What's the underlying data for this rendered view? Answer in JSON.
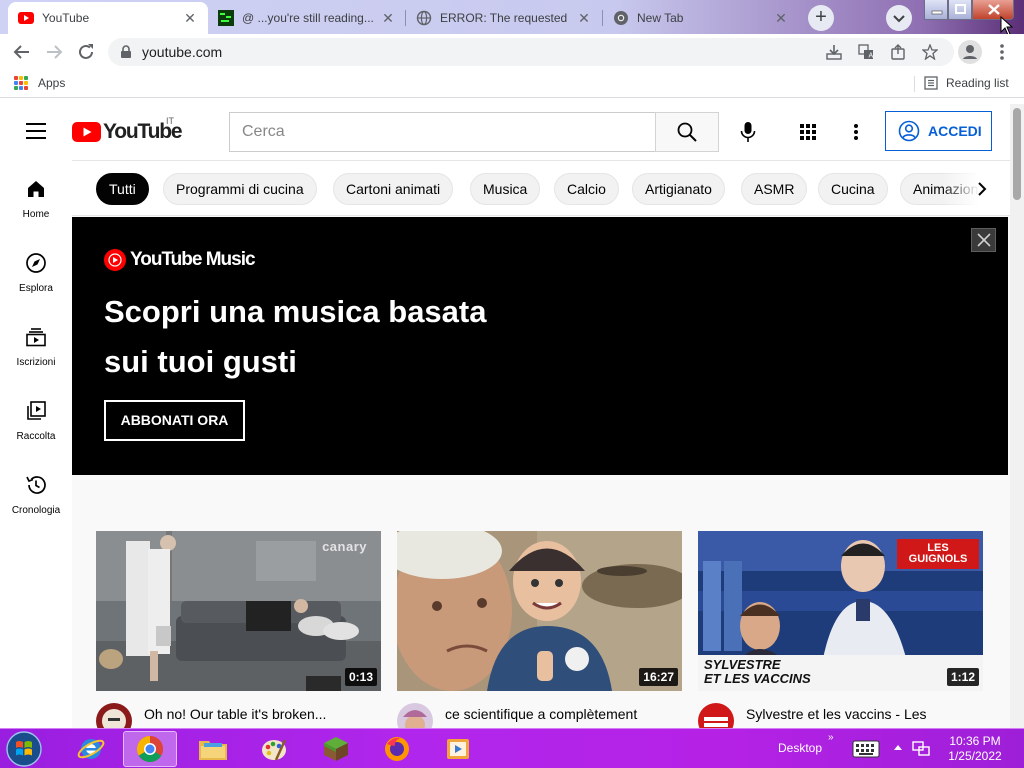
{
  "browser": {
    "tabs": [
      {
        "title": "YouTube",
        "favicon": "youtube-icon",
        "active": true
      },
      {
        "title": "@ ...you're still reading...",
        "favicon": "terminal-icon",
        "active": false
      },
      {
        "title": "ERROR: The requested U",
        "favicon": "globe-icon",
        "active": false
      },
      {
        "title": "New Tab",
        "favicon": "chrome-icon",
        "active": false
      }
    ],
    "url": "youtube.com",
    "bookmarks": {
      "apps_label": "Apps",
      "reading_list_label": "Reading list"
    }
  },
  "youtube": {
    "logo_text": "YouTube",
    "country_code": "IT",
    "search_placeholder": "Cerca",
    "signin_label": "ACCEDI",
    "sidebar": [
      {
        "label": "Home",
        "icon": "home-icon"
      },
      {
        "label": "Esplora",
        "icon": "compass-icon"
      },
      {
        "label": "Iscrizioni",
        "icon": "subscriptions-icon"
      },
      {
        "label": "Raccolta",
        "icon": "library-icon"
      },
      {
        "label": "Cronologia",
        "icon": "history-icon"
      }
    ],
    "chips": [
      "Tutti",
      "Programmi di cucina",
      "Cartoni animati",
      "Musica",
      "Calcio",
      "Artigianato",
      "ASMR",
      "Cucina",
      "Animazione"
    ],
    "selected_chip": "Tutti",
    "banner": {
      "brand": "YouTube Music",
      "headline_line1": "Scopri una musica basata",
      "headline_line2": "sui tuoi gusti",
      "cta": "ABBONATI ORA"
    },
    "videos": [
      {
        "title": "Oh no! Our table it's broken...",
        "duration": "0:13",
        "watermark": "canary"
      },
      {
        "title": "ce scientifique a complètement",
        "duration": "16:27"
      },
      {
        "title": "Sylvestre et les vaccins - Les",
        "duration": "1:12",
        "overlay_top": "LES GUIGNOLS",
        "overlay_caption_1": "SYLVESTRE",
        "overlay_caption_2": "ET LES VACCINS"
      }
    ]
  },
  "taskbar": {
    "desktop_label": "Desktop",
    "time": "10:36 PM",
    "date": "1/25/2022"
  },
  "colors": {
    "youtube_red": "#ff0000",
    "signin_blue": "#065fd4",
    "taskbar_purple": "#b126ec"
  }
}
